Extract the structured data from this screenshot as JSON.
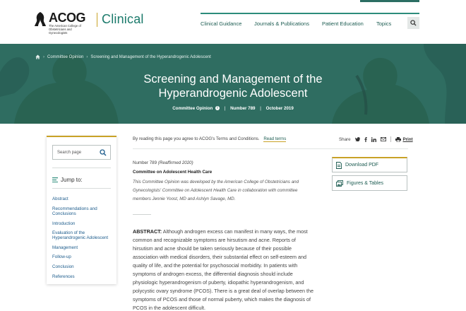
{
  "header": {
    "logo_acog": "ACOG",
    "logo_sub": "The American College of Obstetricians and Gynecologists",
    "logo_clinical": "Clinical",
    "nav": [
      "Clinical Guidance",
      "Journals & Publications",
      "Patient Education",
      "Topics"
    ]
  },
  "breadcrumb": [
    "Committee Opinion",
    "Screening and Management of the Hyperandrogenic Adolescent"
  ],
  "hero": {
    "title_line1": "Screening and Management of the",
    "title_line2": "Hyperandrogenic Adolescent",
    "type": "Committee Opinion",
    "number": "Number 789",
    "date": "October 2019"
  },
  "sidebar": {
    "search_placeholder": "Search page",
    "jump_label": "Jump to:",
    "links": [
      "Abstract",
      "Recommendations and Conclusions",
      "Introduction",
      "Evaluation of the Hyperandrogenic Adolescent",
      "Management",
      "Follow-up",
      "Conclusion",
      "References"
    ]
  },
  "sharebar": {
    "terms_text": "By reading this page you agree to ACOG's Terms and Conditions.",
    "terms_link": "Read terms",
    "share_label": "Share",
    "print_label": "Print"
  },
  "article": {
    "number": "Number 789",
    "reaffirmed": "(Reaffirmed 2020)",
    "committee": "Committee on Adolescent Health Care",
    "note": "This Committee Opinion was developed by the American College of Obstetricians and Gynecologists' Committee on Adolescent Health Care in collaboration with committee members Jennie Yoost, MD and Ashlyn Savage, MD.",
    "abstract_label": "ABSTRACT:",
    "abstract_text": "Although androgen excess can manifest in many ways, the most common and recognizable symptoms are hirsutism and acne. Reports of hirsutism and acne should be taken seriously because of their possible association with medical disorders, their substantial effect on self-esteem and quality of life, and the potential for psychosocial morbidity. In patients with symptoms of androgen excess, the differential diagnosis should include physiologic hyperandrogenism of puberty, idiopathic hyperandrogenism, and polycystic ovary syndrome (PCOS). There is a great deal of overlap between the symptoms of PCOS and those of normal puberty, which makes the diagnosis of PCOS in the adolescent difficult."
  },
  "actions": {
    "download_pdf": "Download PDF",
    "figures_tables": "Figures & Tables"
  },
  "colors": {
    "brand_green": "#2f6d61",
    "accent_gold": "#c9a227",
    "link_teal": "#1d5c52"
  }
}
